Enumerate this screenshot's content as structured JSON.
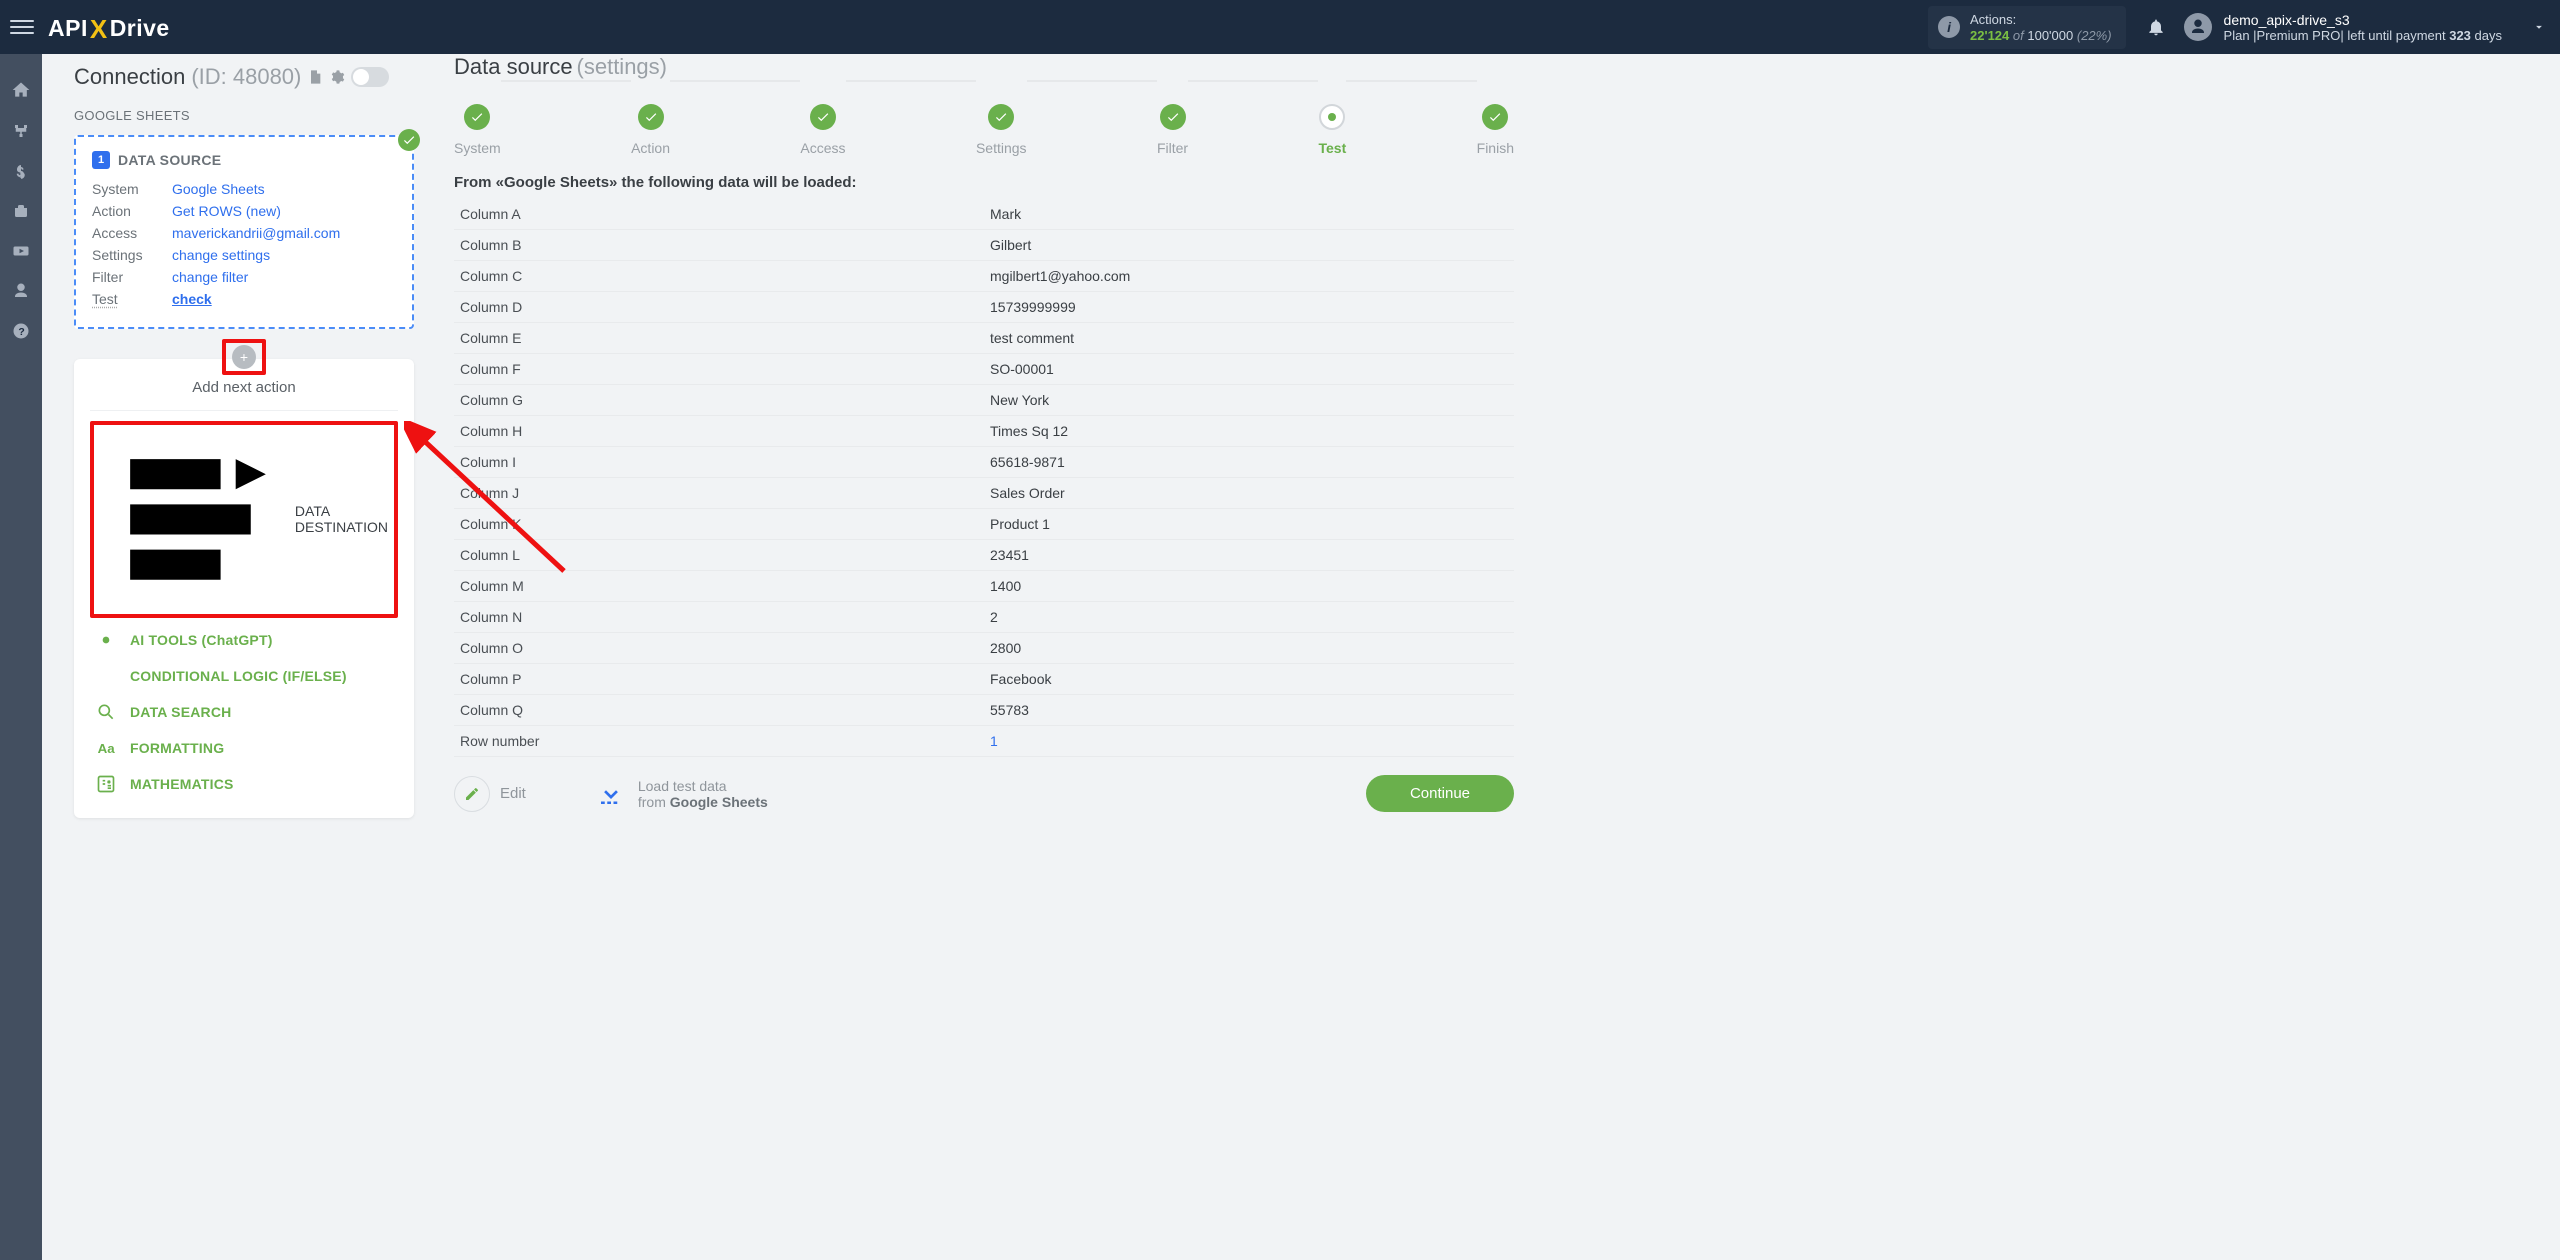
{
  "header": {
    "actions_label": "Actions:",
    "actions_used": "22'124",
    "actions_of": "of",
    "actions_total": "100'000",
    "actions_pct": "(22%)",
    "username": "demo_apix-drive_s3",
    "plan_text_prefix": "Plan |Premium PRO| left until payment ",
    "plan_days_num": "323",
    "plan_days_suffix": " days"
  },
  "left": {
    "conn_title": "Connection",
    "conn_id": "(ID: 48080)",
    "gs_label": "GOOGLE SHEETS",
    "card": {
      "num": "1",
      "title": "DATA SOURCE",
      "rows": {
        "System": "Google Sheets",
        "Action": "Get ROWS (new)",
        "Access": "maverickandrii@gmail.com",
        "Settings": "change settings",
        "Filter": "change filter",
        "Test": "check"
      }
    },
    "add": {
      "title": "Add next action",
      "options": [
        "DATA DESTINATION",
        "AI TOOLS (ChatGPT)",
        "CONDITIONAL LOGIC (IF/ELSE)",
        "DATA SEARCH",
        "FORMATTING",
        "MATHEMATICS"
      ]
    }
  },
  "right": {
    "title": "Data source",
    "subtitle": "(settings)",
    "steps": [
      "System",
      "Action",
      "Access",
      "Settings",
      "Filter",
      "Test",
      "Finish"
    ],
    "from_line": "From «Google Sheets» the following data will be loaded:",
    "rows": [
      [
        "Column A",
        "Mark"
      ],
      [
        "Column B",
        "Gilbert"
      ],
      [
        "Column C",
        "mgilbert1@yahoo.com"
      ],
      [
        "Column D",
        "15739999999"
      ],
      [
        "Column E",
        "test comment"
      ],
      [
        "Column F",
        "SO-00001"
      ],
      [
        "Column G",
        "New York"
      ],
      [
        "Column H",
        "Times Sq 12"
      ],
      [
        "Column I",
        "65618-9871"
      ],
      [
        "Column J",
        "Sales Order"
      ],
      [
        "Column K",
        "Product 1"
      ],
      [
        "Column L",
        "23451"
      ],
      [
        "Column M",
        "1400"
      ],
      [
        "Column N",
        "2"
      ],
      [
        "Column O",
        "2800"
      ],
      [
        "Column P",
        "Facebook"
      ],
      [
        "Column Q",
        "55783"
      ],
      [
        "Row number",
        "1"
      ]
    ],
    "edit_label": "Edit",
    "load_line1": "Load test data",
    "load_line2_prefix": "from ",
    "load_line2_bold": "Google Sheets",
    "continue": "Continue"
  }
}
